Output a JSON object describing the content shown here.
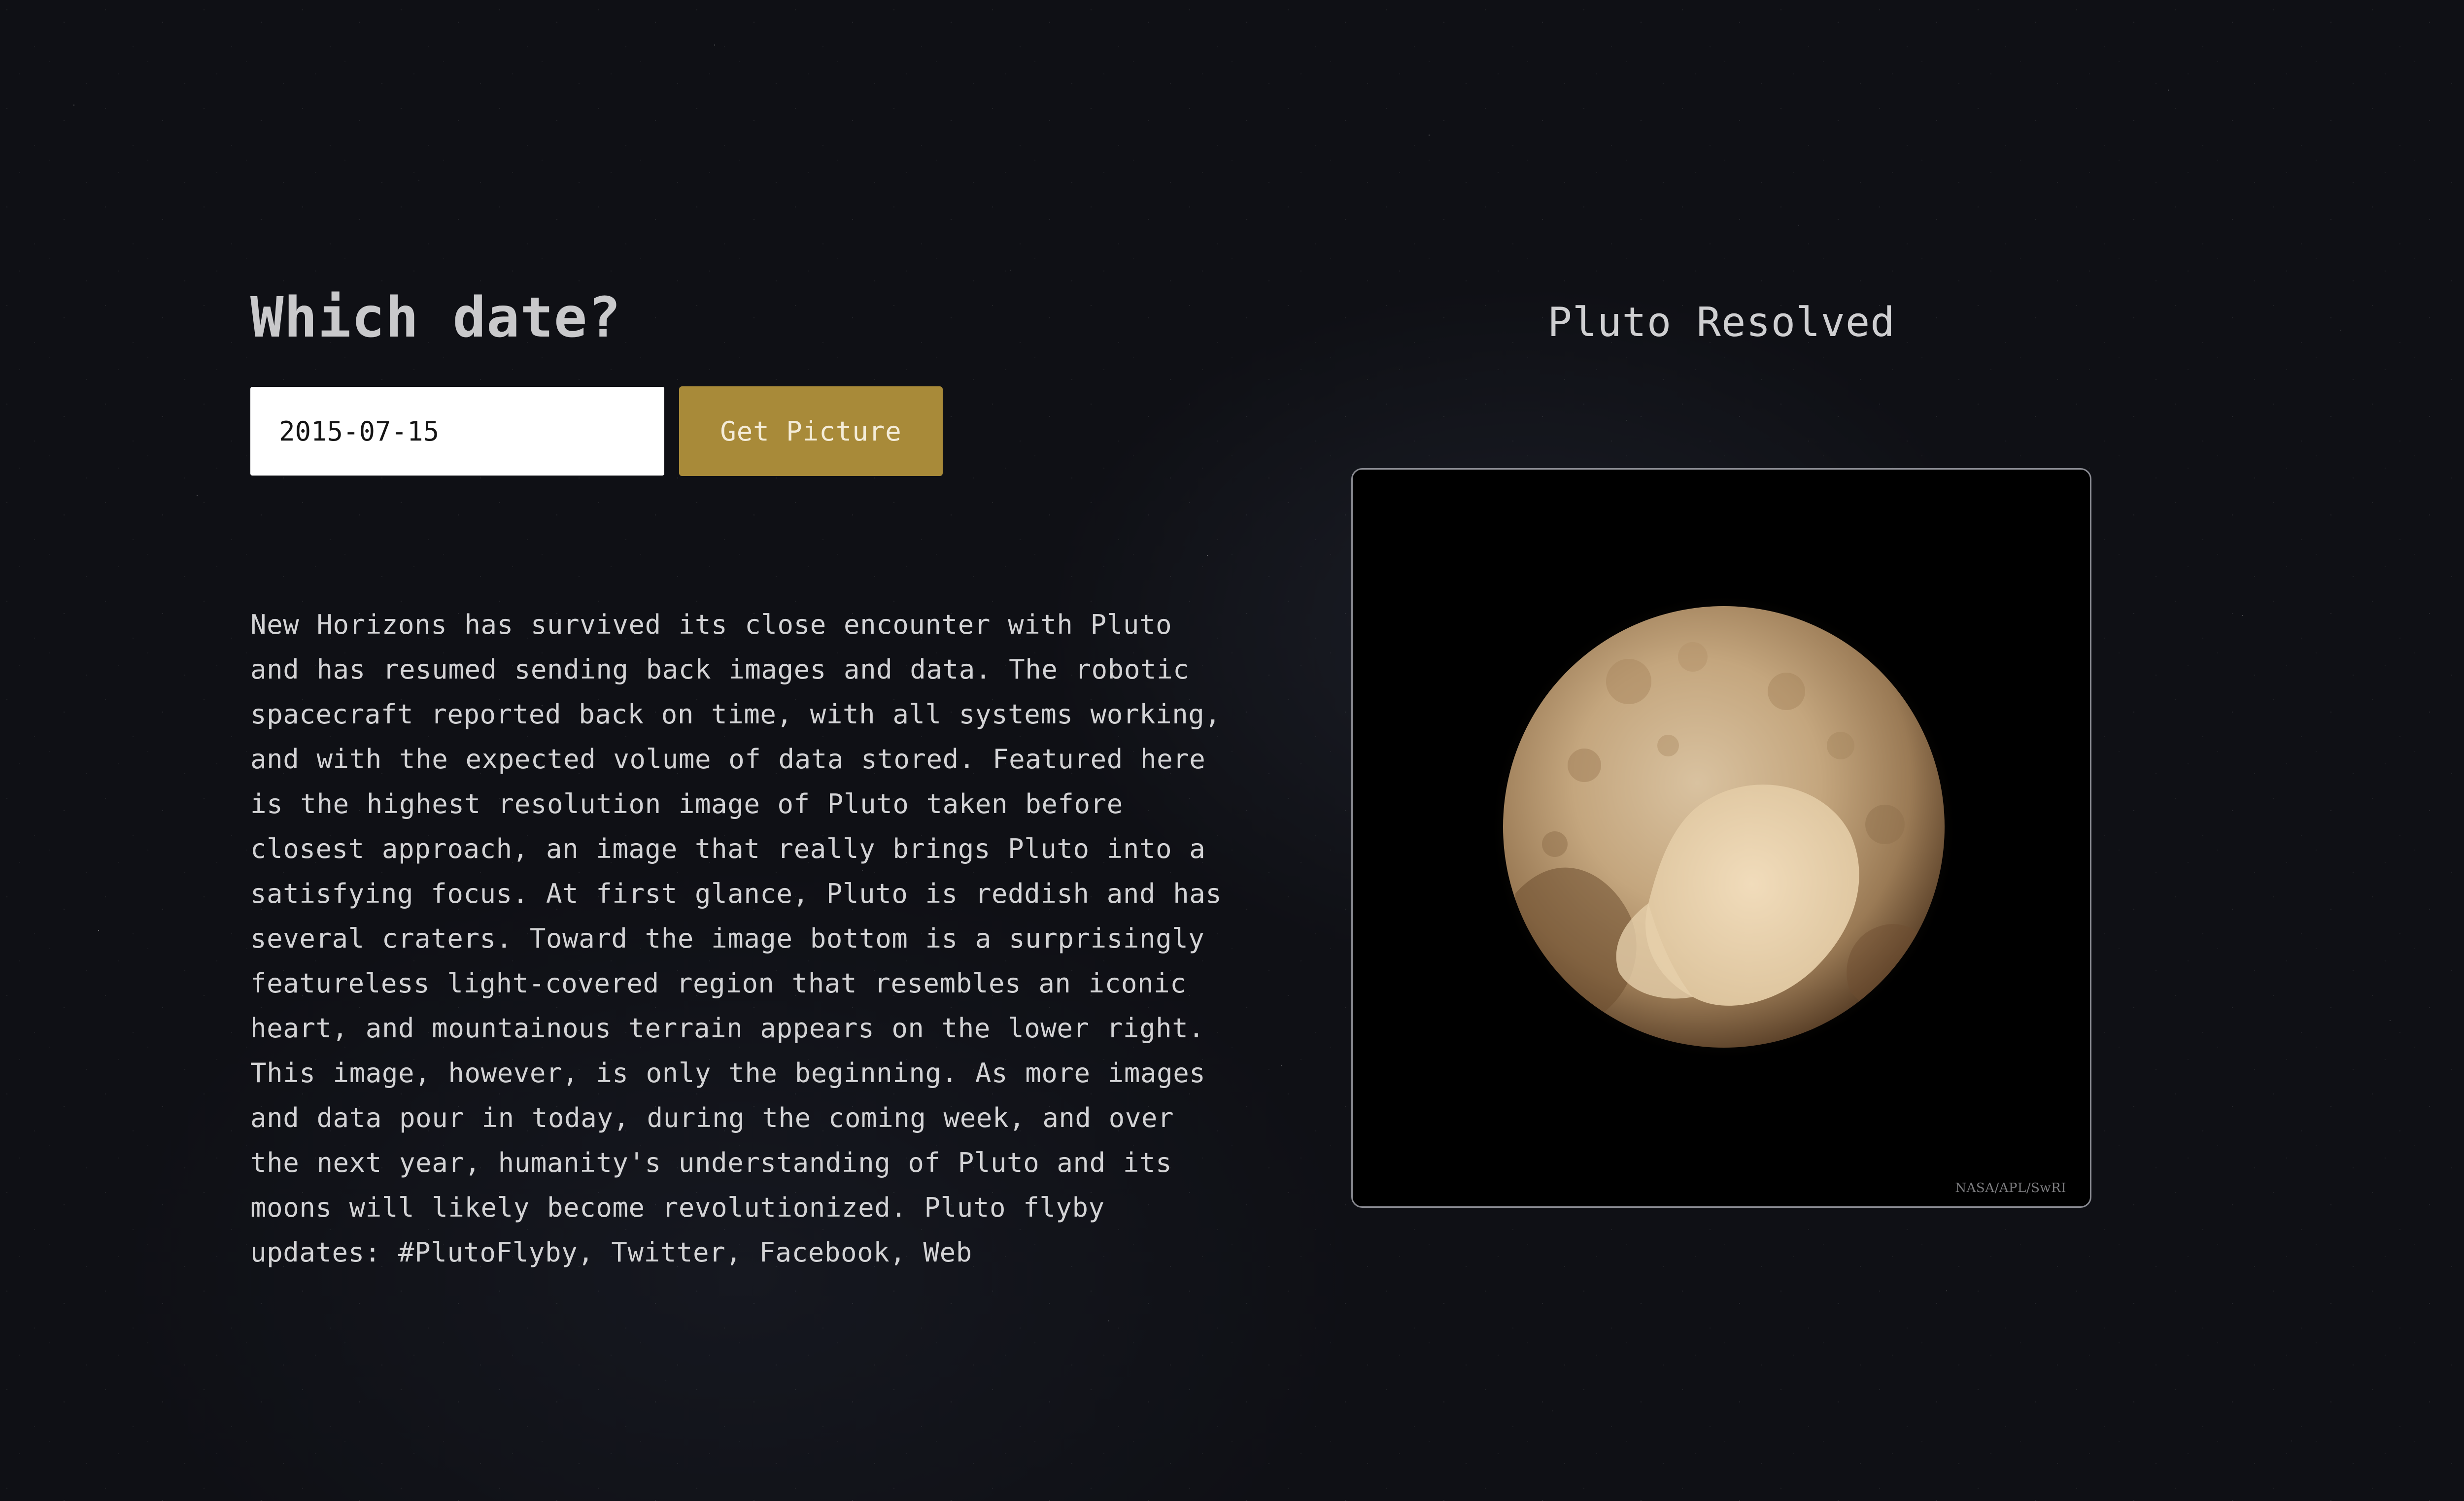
{
  "form": {
    "heading": "Which date?",
    "date_value": "2015-07-15",
    "button_label": "Get Picture"
  },
  "apod": {
    "title": "Pluto Resolved",
    "explanation": "New Horizons has survived its close encounter with Pluto and has resumed sending back images and data. The robotic spacecraft reported back on time, with all systems working, and with the expected volume of data stored. Featured here is the highest resolution image of Pluto taken before closest approach, an image that really brings Pluto into a satisfying focus. At first glance, Pluto is reddish and has several craters. Toward the image bottom is a surprisingly featureless light-covered region that resembles an iconic heart, and mountainous terrain appears on the lower right. This image, however, is only the beginning. As more images and data pour in today, during the coming week, and over the next year, humanity's understanding of Pluto and its moons will likely become revolutionized. Pluto flyby updates: #PlutoFlyby, Twitter, Facebook, Web",
    "image_credit": "NASA/APL/SwRI",
    "image_subject": "pluto-photo"
  },
  "colors": {
    "background": "#0f1015",
    "button": "#a88a39",
    "input_background": "#ffffff",
    "text": "#d3d3d5"
  }
}
